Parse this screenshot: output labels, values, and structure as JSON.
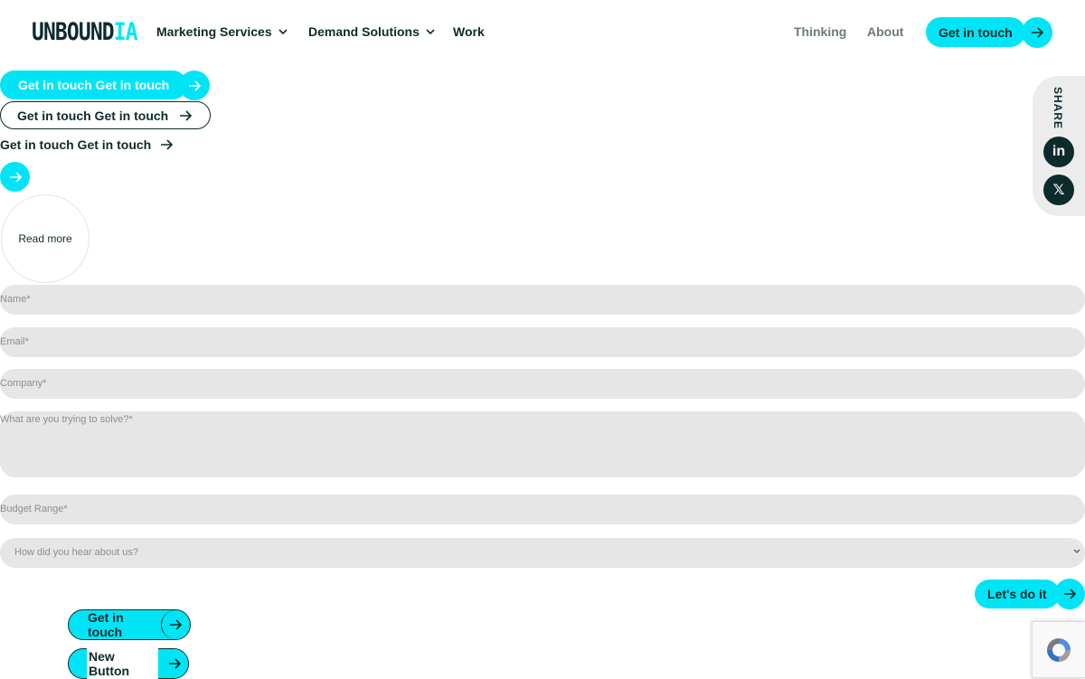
{
  "brand": {
    "logo_main": "UNBOUND",
    "logo_accent": "IA"
  },
  "nav": {
    "items": [
      {
        "label": "Marketing Services"
      },
      {
        "label": "Demand Solutions"
      },
      {
        "label": "Work"
      }
    ],
    "right": [
      {
        "label": "Thinking"
      },
      {
        "label": "About"
      }
    ],
    "cta": "Get in touch"
  },
  "buttons": {
    "b1": "Get in touch Get in touch",
    "b2": "Get in touch Get in touch",
    "b3": "Get in touch Get in touch",
    "read_more": "Read more"
  },
  "share": {
    "label": "SHARE",
    "linkedin": "in",
    "x": "𝕏"
  },
  "form": {
    "name": "Name*",
    "email": "Email*",
    "company": "Company*",
    "problem": "What are you trying to solve?*",
    "budget": "Budget Range*",
    "source": "How did you hear about us?",
    "submit": "Let's do it"
  },
  "demo": {
    "get_in_touch": "Get in touch",
    "new_button": "New Button"
  },
  "colors": {
    "accent": "#00e5f5",
    "dark": "#0d2b2b",
    "field": "#e6e6e6"
  }
}
